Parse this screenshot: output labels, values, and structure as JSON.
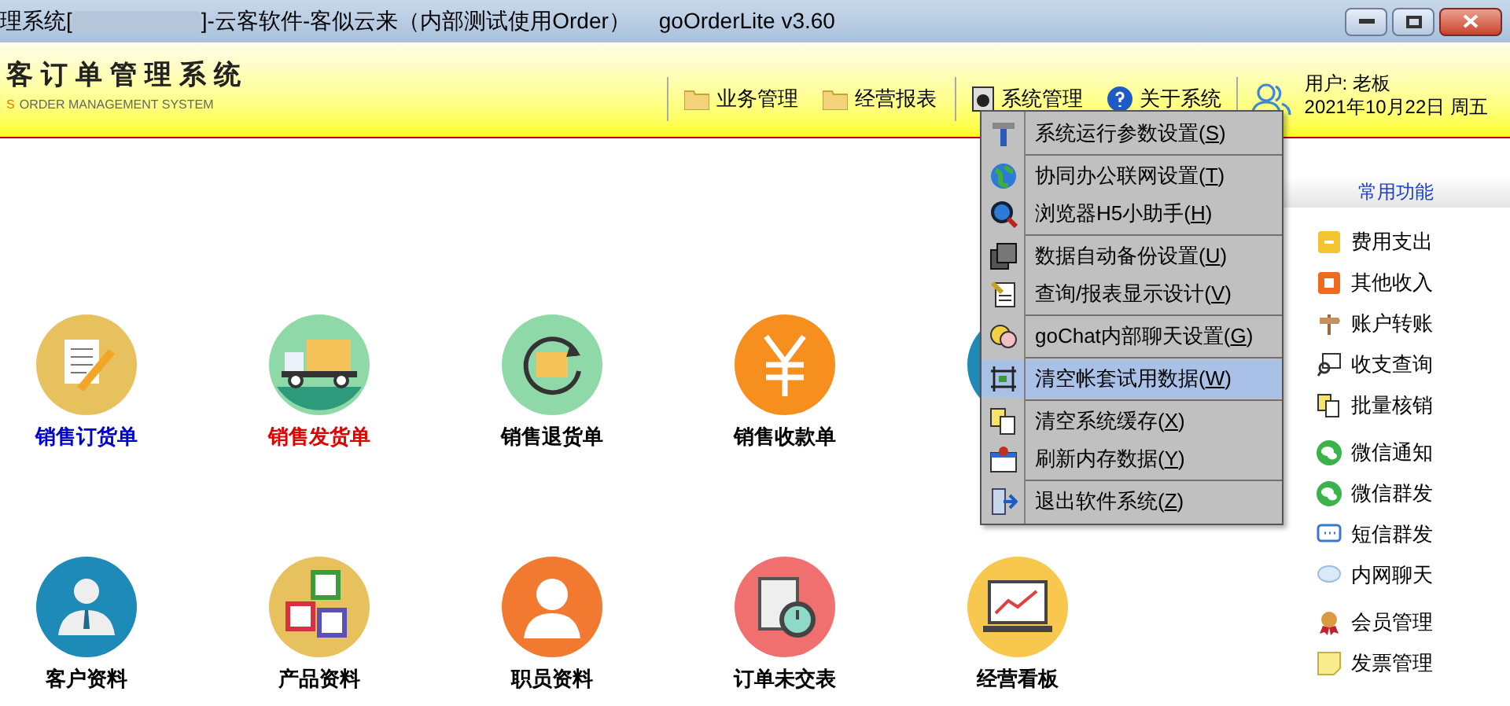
{
  "window": {
    "title_before": "理系统[",
    "title_after": "]-云客软件-客似云来（内部测试使用Order）",
    "version": "goOrderLite v3.60"
  },
  "logo": {
    "title": "客订单管理系统",
    "subtitle_accent": "S",
    "subtitle": "ORDER MANAGEMENT SYSTEM"
  },
  "nav": [
    {
      "label": "业务管理",
      "kind": "folder"
    },
    {
      "label": "经营报表",
      "kind": "folder"
    },
    {
      "label": "系统管理",
      "kind": "system"
    },
    {
      "label": "关于系统",
      "kind": "help"
    }
  ],
  "user": {
    "name": "用户: 老板",
    "date": "2021年10月22日 周五"
  },
  "functions": [
    [
      {
        "label": "销售订货单",
        "color": "#0000cc",
        "kind": "order"
      },
      {
        "label": "销售发货单",
        "color": "#e00000",
        "kind": "truck"
      },
      {
        "label": "销售退货单",
        "color": "#000000",
        "kind": "return"
      },
      {
        "label": "销售收款单",
        "color": "#000000",
        "kind": "yen"
      }
    ],
    [
      {
        "label": "客户资料",
        "color": "#000000",
        "kind": "customer"
      },
      {
        "label": "产品资料",
        "color": "#000000",
        "kind": "blocks"
      },
      {
        "label": "职员资料",
        "color": "#000000",
        "kind": "staff"
      },
      {
        "label": "订单未交表",
        "color": "#000000",
        "kind": "timer"
      },
      {
        "label": "经营看板",
        "color": "#000000",
        "kind": "board"
      }
    ]
  ],
  "sidebar": {
    "title": "常用功能",
    "groups": [
      [
        {
          "label": "费用支出",
          "kind": "expense"
        },
        {
          "label": "其他收入",
          "kind": "income"
        },
        {
          "label": "账户转账",
          "kind": "sign"
        },
        {
          "label": "收支查询",
          "kind": "query"
        },
        {
          "label": "批量核销",
          "kind": "pages"
        }
      ],
      [
        {
          "label": "微信通知",
          "kind": "wechat"
        },
        {
          "label": "微信群发",
          "kind": "wechat"
        },
        {
          "label": "短信群发",
          "kind": "sms"
        },
        {
          "label": "内网聊天",
          "kind": "bubble"
        }
      ],
      [
        {
          "label": "会员管理",
          "kind": "medal"
        },
        {
          "label": "发票管理",
          "kind": "note"
        }
      ]
    ]
  },
  "menu": {
    "groups": [
      [
        {
          "before": "系统运行参数设置(",
          "key": "S",
          "after": ")",
          "kind": "hammer",
          "selected": false
        }
      ],
      [
        {
          "before": "协同办公联网设置(",
          "key": "T",
          "after": ")",
          "kind": "globe",
          "selected": false
        },
        {
          "before": "浏览器H5小助手(",
          "key": "H",
          "after": ")",
          "kind": "search",
          "selected": false
        }
      ],
      [
        {
          "before": "数据自动备份设置(",
          "key": "U",
          "after": ")",
          "kind": "disk",
          "selected": false
        },
        {
          "before": "查询/报表显示设计(",
          "key": "V",
          "after": ")",
          "kind": "design",
          "selected": false
        }
      ],
      [
        {
          "before": "goChat内部聊天设置(",
          "key": "G",
          "after": ")",
          "kind": "chat",
          "selected": false
        }
      ],
      [
        {
          "before": "清空帐套试用数据(",
          "key": "W",
          "after": ")",
          "kind": "clear",
          "selected": true
        }
      ],
      [
        {
          "before": "清空系统缓存(",
          "key": "X",
          "after": ")",
          "kind": "pages",
          "selected": false
        },
        {
          "before": "刷新内存数据(",
          "key": "Y",
          "after": ")",
          "kind": "refresh",
          "selected": false
        }
      ],
      [
        {
          "before": "退出软件系统(",
          "key": "Z",
          "after": ")",
          "kind": "exit",
          "selected": false
        }
      ]
    ]
  }
}
